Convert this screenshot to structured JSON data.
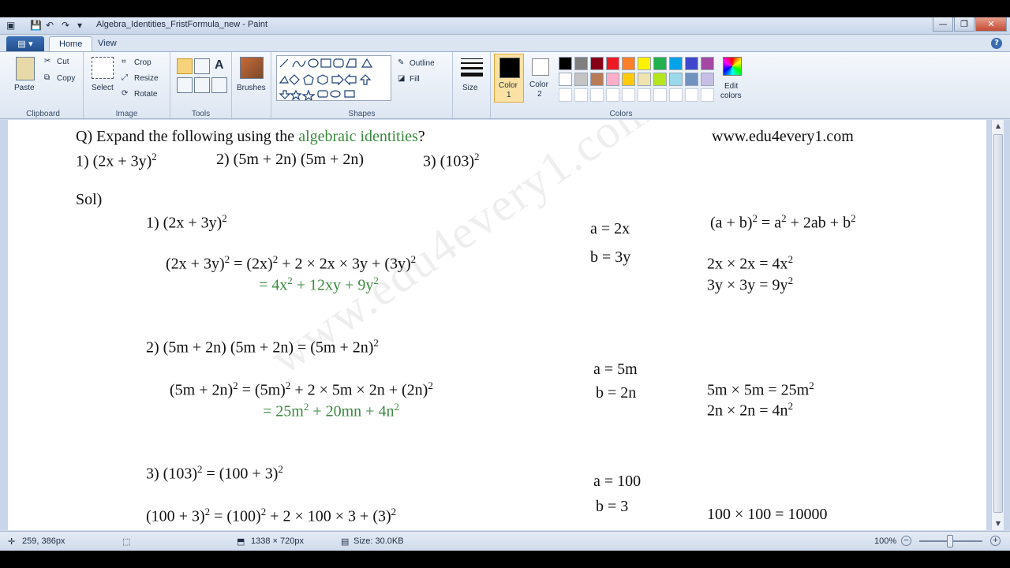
{
  "window": {
    "title": "Algebra_Identities_FristFormula_new - Paint",
    "buttons": {
      "minimize": "—",
      "maximize": "❐",
      "close": "✕"
    }
  },
  "tabs": {
    "file": "▤ ▾",
    "home": "Home",
    "view": "View",
    "help": "?"
  },
  "ribbon": {
    "clipboard": {
      "label": "Clipboard",
      "paste": "Paste",
      "cut": "Cut",
      "copy": "Copy"
    },
    "image": {
      "label": "Image",
      "select": "Select",
      "crop": "Crop",
      "resize": "Resize",
      "rotate": "Rotate"
    },
    "tools": {
      "label": "Tools",
      "text_tool": "A"
    },
    "brushes": {
      "label": "Brushes"
    },
    "shapes": {
      "label": "Shapes",
      "outline": "Outline",
      "fill": "Fill"
    },
    "size": {
      "label": "Size"
    },
    "colors": {
      "label": "Colors",
      "color1": "Color\n1",
      "color1_top": "Color",
      "color1_bot": "1",
      "color2_top": "Color",
      "color2_bot": "2",
      "edit": "Edit",
      "edit2": "colors",
      "primary": "#000000",
      "secondary": "#ffffff",
      "palette_row1": [
        "#000000",
        "#7f7f7f",
        "#880015",
        "#ed1c24",
        "#ff7f27",
        "#fff200",
        "#22b14c",
        "#00a2e8",
        "#3f48cc",
        "#a349a4"
      ],
      "palette_row2": [
        "#ffffff",
        "#c3c3c3",
        "#b97a57",
        "#ffaec9",
        "#ffc90e",
        "#efe4b0",
        "#b5e61d",
        "#99d9ea",
        "#7092be",
        "#c8bfe7"
      ]
    }
  },
  "doc": {
    "q_prefix": "Q) Expand the following using the ",
    "q_green": "algebraic identities",
    "q_suffix": "?",
    "site": "www.edu4every1.com",
    "p1": "1) (2x + 3y)",
    "p2": "2) (5m + 2n) (5m + 2n)",
    "p3": "3) (103)",
    "sol": "Sol)",
    "s1_title": "1) (2x + 3y)",
    "s1_l1a": "(2x + 3y)",
    "s1_l1b": " = (2x)",
    "s1_l1c": " + 2 × 2x × 3y + (3y)",
    "s1_l2a": "= 4x",
    "s1_l2b": " + 12xy + 9y",
    "a1": "a = 2x",
    "b1": "b = 3y",
    "id1a": "(a + b)",
    "id1b": " = a",
    "id1c": " + 2ab + b",
    "r1a": "2x × 2x = 4x",
    "r1b": "3y × 3y = 9y",
    "s2_title_a": "2) (5m + 2n) (5m + 2n) = (5m + 2n)",
    "s2_l1a": "(5m + 2n)",
    "s2_l1b": " = (5m)",
    "s2_l1c": " + 2 × 5m × 2n + (2n)",
    "s2_l2a": "= 25m",
    "s2_l2b": " + 20mn + 4n",
    "a2": "a = 5m",
    "b2": "b = 2n",
    "r2a": "5m × 5m = 25m",
    "r2b": "2n × 2n = 4n",
    "s3_title_a": "3) (103)",
    "s3_title_b": " = (100 + 3)",
    "s3_l1a": "(100 + 3)",
    "s3_l1b": " = (100)",
    "s3_l1c": " + 2 × 100 × 3 + (3)",
    "a3": "a = 100",
    "b3": "b = 3",
    "r3a": "100 × 100 = 10000",
    "sup2": "2",
    "watermark": "www.edu4every1.com"
  },
  "status": {
    "cursor_pos": "259, 386px",
    "canvas_size": "1338 × 720px",
    "file_size": "Size: 30.0KB",
    "zoom": "100%"
  }
}
